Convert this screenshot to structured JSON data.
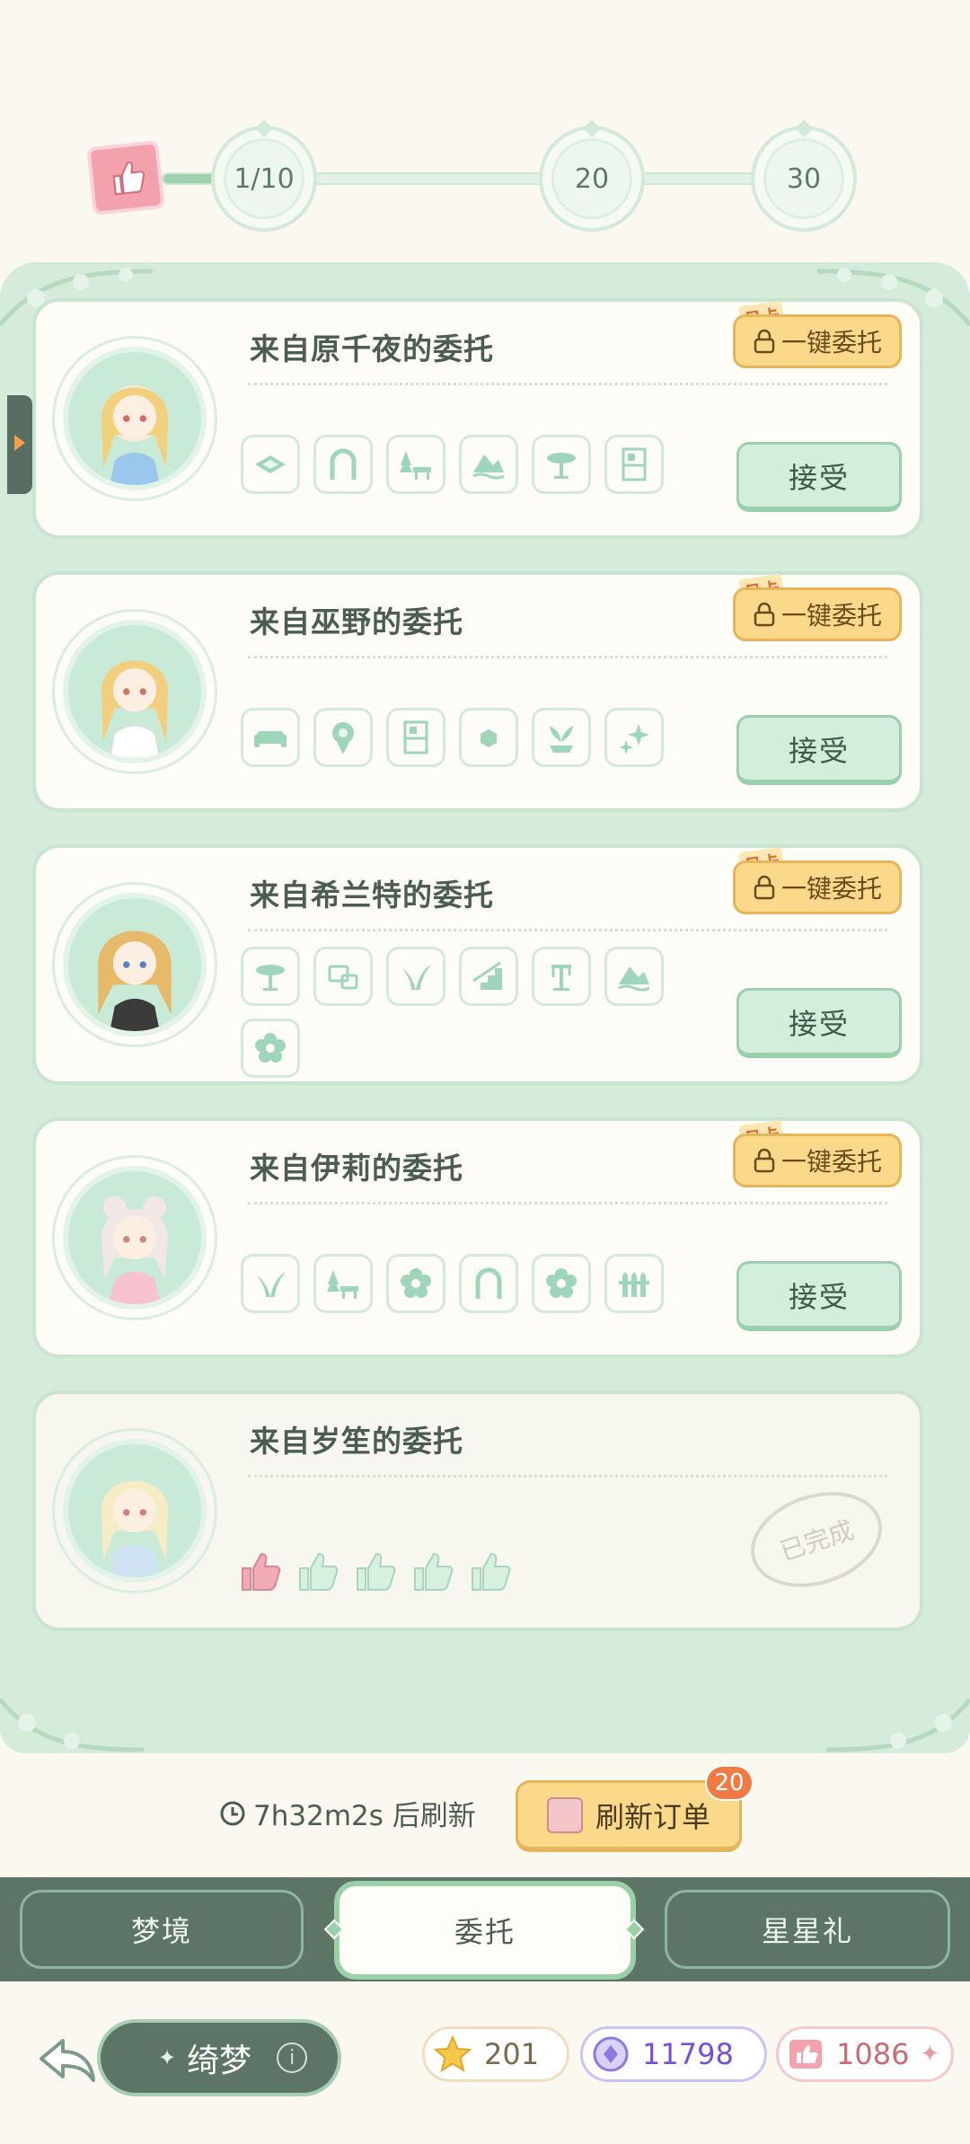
{
  "progress": {
    "fill_fraction": 0.1,
    "milestones": [
      "1/10",
      "20",
      "30"
    ]
  },
  "commissions": [
    {
      "title": "来自原千夜的委托",
      "month_tag": "月卡",
      "one_key_label": "一键委托",
      "accept_label": "接受",
      "items": [
        "floor-tile-icon",
        "arch-icon",
        "garden-bench-icon",
        "waves-icon",
        "round-table-icon",
        "cabinet-icon"
      ]
    },
    {
      "title": "来自巫野的委托",
      "month_tag": "月卡",
      "one_key_label": "一键委托",
      "accept_label": "接受",
      "items": [
        "sofa-icon",
        "bouquet-icon",
        "cabinet-icon",
        "cube-icon",
        "potted-plant-icon",
        "sparkle-icon"
      ]
    },
    {
      "title": "来自希兰特的委托",
      "month_tag": "月卡",
      "one_key_label": "一键委托",
      "accept_label": "接受",
      "items": [
        "round-table-icon",
        "tv-icon",
        "grass-icon",
        "stairs-icon",
        "lamp-icon",
        "waves-icon",
        "flower-icon"
      ]
    },
    {
      "title": "来自伊莉的委托",
      "month_tag": "月卡",
      "one_key_label": "一键委托",
      "accept_label": "接受",
      "items": [
        "grass-icon",
        "garden-bench-icon",
        "flower-icon",
        "arch-icon",
        "flower-icon",
        "fence-icon"
      ]
    },
    {
      "title": "来自岁笙的委托",
      "status": "已完成",
      "rating": 1,
      "rating_max": 5
    }
  ],
  "refresh": {
    "timer": "7h32m2s 后刷新",
    "button_label": "刷新订单",
    "badge": "20"
  },
  "tabs": [
    {
      "label": "梦境"
    },
    {
      "label": "委托"
    },
    {
      "label": "星星礼"
    }
  ],
  "bottom": {
    "title": "绮梦",
    "info": "i",
    "currencies": {
      "star": "201",
      "gem": "11798",
      "like": "1086"
    }
  },
  "colors": {
    "panel_bg": "#d4ecd9",
    "accent_green": "#9bd1a9",
    "gold_button": "#fbd98a",
    "tab_bar": "#5d7566",
    "badge_orange": "#ef7a44"
  }
}
